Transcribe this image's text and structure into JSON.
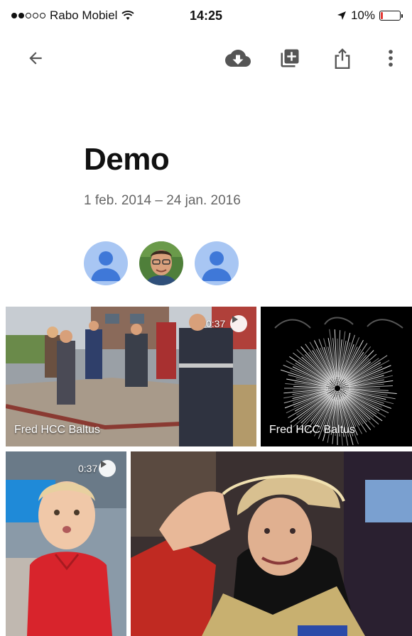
{
  "status_bar": {
    "carrier": "Rabo Mobiel",
    "time": "14:25",
    "battery": "10%",
    "battery_level": 0.1,
    "battery_color": "#e53935"
  },
  "toolbar": {
    "back_icon": "arrow-left-icon",
    "download_icon": "cloud-download-icon",
    "add_icon": "add-to-library-icon",
    "share_icon": "share-icon",
    "more_icon": "more-vertical-icon"
  },
  "album": {
    "title": "Demo",
    "date_range": "1 feb. 2014 – 24 jan. 2016"
  },
  "contributors": [
    {
      "type": "generic",
      "icon": "person-icon"
    },
    {
      "type": "photo",
      "icon": "person-photo"
    },
    {
      "type": "generic",
      "icon": "person-icon"
    }
  ],
  "media": [
    {
      "type": "video",
      "duration": "0:37",
      "label": "Fred HCC Baltus"
    },
    {
      "type": "photo",
      "label": "Fred HCC Baltus"
    },
    {
      "type": "video",
      "duration": "0:37"
    },
    {
      "type": "photo"
    }
  ],
  "colors": {
    "avatar_bg": "#a8c6f3",
    "avatar_fg": "#3f78d8",
    "icon": "#555555"
  }
}
